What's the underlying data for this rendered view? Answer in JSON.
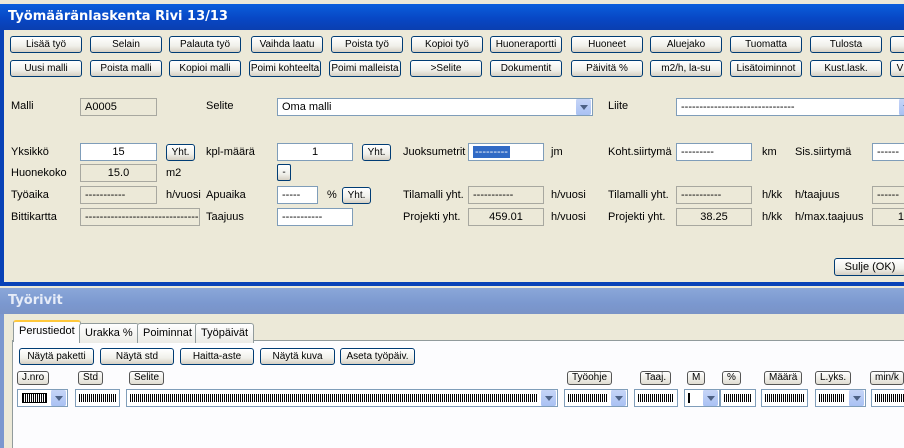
{
  "main_window": {
    "title": "Työmääränlaskenta  Rivi 13/13",
    "toolbar_row1": [
      "Lisää työ",
      "Selain",
      "Palauta työ",
      "Vaihda laatu",
      "Poista työ",
      "Kopioi työ",
      "Huoneraportti",
      "Huoneet",
      "Aluejako",
      "Tuomatta",
      "Tulosta",
      ""
    ],
    "toolbar_row2": [
      "Uusi malli",
      "Poista malli",
      "Kopioi malli",
      "Poimi kohteelta",
      "Poimi malleista",
      ">Selite",
      "Dokumentit",
      "Päivitä %",
      "m2/h, la-su",
      "Lisätoiminnot",
      "Kust.lask.",
      "V"
    ],
    "fields": {
      "malli_label": "Malli",
      "malli_value": "A0005",
      "selite_label": "Selite",
      "selite_value": "Oma malli",
      "liite_label": "Liite",
      "liite_value": "-------------------------------",
      "yksikko_label": "Yksikkö",
      "yksikko_value": "15",
      "yht_btn1": "Yht.",
      "kplmaara_label": "kpl-määrä",
      "kplmaara_value": "1",
      "yht_btn2": "Yht.",
      "juoksumetrit_label": "Juoksumetrit",
      "juoksumetrit_value": "---------",
      "jm_unit": "jm",
      "koht_siirtyma_label": "Koht.siirtymä",
      "koht_siirtyma_value": "---------",
      "km_unit": "km",
      "sis_siirtyma_label": "Sis.siirtymä",
      "sis_siirtyma_value": "------",
      "huonekoko_label": "Huonekoko",
      "huonekoko_value": "15.0",
      "m2_unit": "m2",
      "minus_btn": "-",
      "tyoaika_label": "Työaika",
      "tyoaika_value": "-----------",
      "hvuosi_unit1": "h/vuosi",
      "apuaika_label": "Apuaika",
      "apuaika_value": "-----",
      "percent": "%",
      "yht_btn3": "Yht.",
      "tilamalli_label1": "Tilamalli yht.",
      "tilamalli_value1": "-----------",
      "hvuosi_unit2": "h/vuosi",
      "tilamalli_label2": "Tilamalli yht.",
      "tilamalli_value2": "-----------",
      "hkk_unit1": "h/kk",
      "htaajuus_label": "h/taajuus",
      "htaajuus_value": "------",
      "bittikartta_label": "Bittikartta",
      "bittikartta_value": "-------------------------------",
      "taajuus_label": "Taajuus",
      "taajuus_value": "-----------",
      "projekti_label1": "Projekti yht.",
      "projekti_value1": "459.01",
      "hvuosi_unit3": "h/vuosi",
      "projekti_label2": "Projekti yht.",
      "projekti_value2": "38.25",
      "hkk_unit2": "h/kk",
      "hmaxtaajuus_label": "h/max.taajuus",
      "hmaxtaajuus_value": "1."
    },
    "close_button": "Sulje (OK)"
  },
  "rows_window": {
    "title": "Työrivit",
    "tabs": [
      "Perustiedot",
      "Urakka %",
      "Poiminnat",
      "Työpäivät"
    ],
    "buttons": [
      "Näytä paketti",
      "Näytä std",
      "Haitta-aste",
      "Näytä kuva",
      "Aseta työpäiv."
    ],
    "columns": [
      "J.nro",
      "Std",
      "Selite",
      "Työohje",
      "Taaj.",
      "M",
      "%",
      "Määrä",
      "L.yks.",
      "min/k"
    ]
  }
}
